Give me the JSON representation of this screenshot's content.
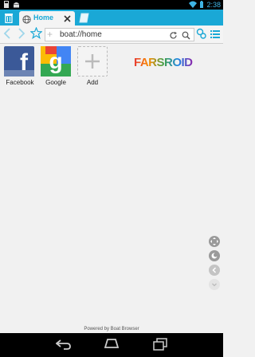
{
  "status": {
    "time": "2:38"
  },
  "tab": {
    "title": "Home"
  },
  "address": {
    "url": "boat://home"
  },
  "tiles": [
    {
      "label": "Facebook"
    },
    {
      "label": "Google"
    },
    {
      "label": "Add"
    }
  ],
  "logo": {
    "text": "FARSROID"
  },
  "footer": {
    "powered": "Powered by Boat Browser"
  },
  "colors": {
    "accent": "#1aa8d6",
    "facebook": "#3b5998"
  }
}
